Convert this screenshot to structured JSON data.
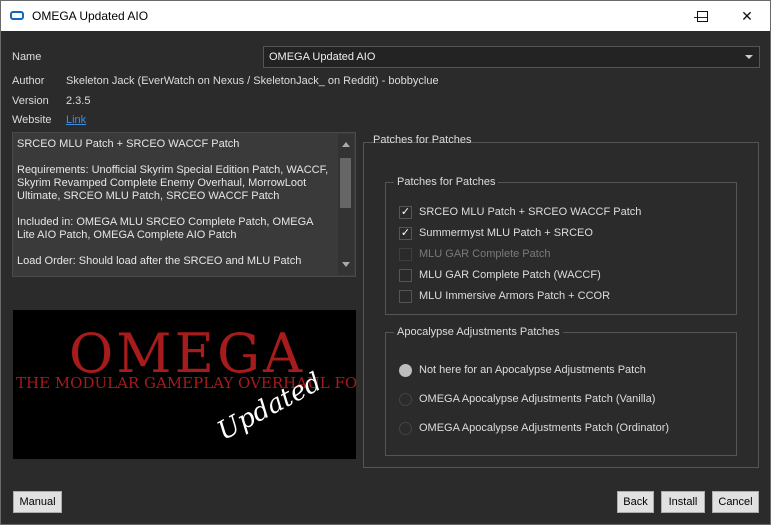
{
  "window": {
    "title": "OMEGA Updated AIO",
    "minimize_glyph": "—",
    "maximize_glyph": "☐",
    "close_glyph": "✕"
  },
  "info": {
    "name_label": "Name",
    "name_value": "OMEGA Updated AIO",
    "author_label": "Author",
    "author_value": "Skeleton Jack (EverWatch on Nexus / SkeletonJack_ on Reddit) - bobbyclue",
    "version_label": "Version",
    "version_value": "2.3.5",
    "website_label": "Website",
    "website_link": "Link"
  },
  "description": "SRCEO MLU Patch + SRCEO WACCF Patch\n\nRequirements: Unofficial Skyrim Special Edition Patch, WACCF, Skyrim Revamped Complete Enemy Overhaul, MorrowLoot Ultimate, SRCEO MLU Patch, SRCEO WACCF Patch\n\nIncluded in: OMEGA MLU SRCEO Complete Patch, OMEGA Lite AIO Patch, OMEGA Complete AIO Patch\n\nLoad Order: Should load after the SRCEO and MLU Patch",
  "banner": {
    "title": "OMEGA",
    "subtitle": "THE MODULAR GAMEPLAY OVERHAUL FOR SSE",
    "overlay": "Updated"
  },
  "page": {
    "title": "Patches for Patches",
    "groups": [
      {
        "title": "Patches for Patches",
        "type": "checkbox",
        "items": [
          {
            "label": "SRCEO MLU Patch + SRCEO WACCF Patch",
            "checked": true,
            "disabled": false
          },
          {
            "label": "Summermyst MLU Patch + SRCEO",
            "checked": true,
            "disabled": false
          },
          {
            "label": "MLU GAR Complete Patch",
            "checked": false,
            "disabled": true
          },
          {
            "label": "MLU GAR Complete Patch (WACCF)",
            "checked": false,
            "disabled": false
          },
          {
            "label": "MLU Immersive Armors Patch + CCOR",
            "checked": false,
            "disabled": false
          }
        ]
      },
      {
        "title": "Apocalypse Adjustments Patches",
        "type": "radio",
        "items": [
          {
            "label": "Not here for an Apocalypse Adjustments Patch",
            "selected": true
          },
          {
            "label": "OMEGA Apocalypse Adjustments Patch (Vanilla)",
            "selected": false
          },
          {
            "label": "OMEGA Apocalypse Adjustments Patch (Ordinator)",
            "selected": false
          }
        ]
      }
    ]
  },
  "buttons": {
    "manual": "Manual",
    "back": "Back",
    "install": "Install",
    "cancel": "Cancel"
  },
  "colors": {
    "background": "#2b2b2b",
    "link": "#3a8ee6",
    "banner_red": "#a61b1b"
  },
  "icons": {
    "check": "✓"
  }
}
